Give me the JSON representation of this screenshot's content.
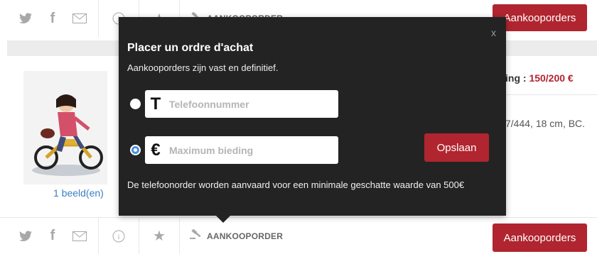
{
  "top_bar": {
    "icons": [
      "twitter-icon",
      "facebook-icon",
      "mail-icon",
      "info-icon",
      "star-icon",
      "gavel-icon"
    ],
    "aankoop_link": "AANKOOPORDER",
    "button_label": "Aankooporders"
  },
  "product": {
    "images_link": "1 beeld(en)",
    "price_prefix": "ing : ",
    "price_value": "150/200 €",
    "desc": "7/444, 18 cm, BC."
  },
  "modal": {
    "title": "Placer un ordre d'achat",
    "subtitle": "Aankooporders zijn vast en definitief.",
    "phone_glyph": "T",
    "phone_placeholder": "Telefoonnummer",
    "bid_glyph": "€",
    "bid_placeholder": "Maximum bieding",
    "save_label": "Opslaan",
    "close": "x",
    "note": "De telefoonorder worden aanvaard voor een minimale geschatte waarde van 500€"
  },
  "bottom_bar": {
    "aankoop_link": "AANKOOPORDER",
    "button_label": "Aankooporders"
  },
  "colors": {
    "accent": "#b0252f",
    "modal_bg": "#232323",
    "link": "#3a7fc1"
  }
}
